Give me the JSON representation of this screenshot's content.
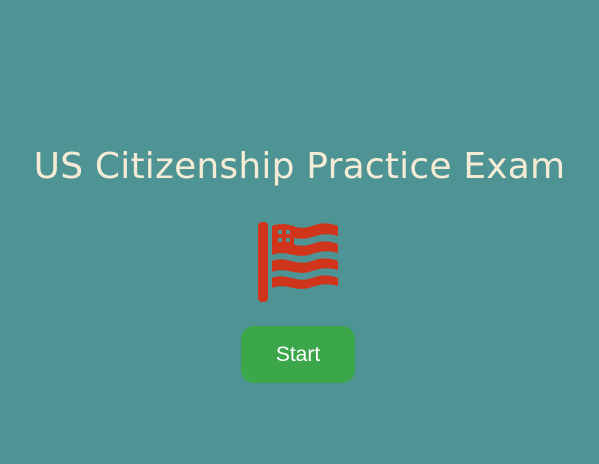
{
  "colors": {
    "background": "#4f9494",
    "title_text": "#f6ecd6",
    "flag": "#d0341a",
    "button_bg": "#3ba74a",
    "button_text": "#ffffff"
  },
  "title": "US Citizenship Practice Exam",
  "flag_icon": "us-flag-icon",
  "start_button": {
    "label": "Start"
  }
}
